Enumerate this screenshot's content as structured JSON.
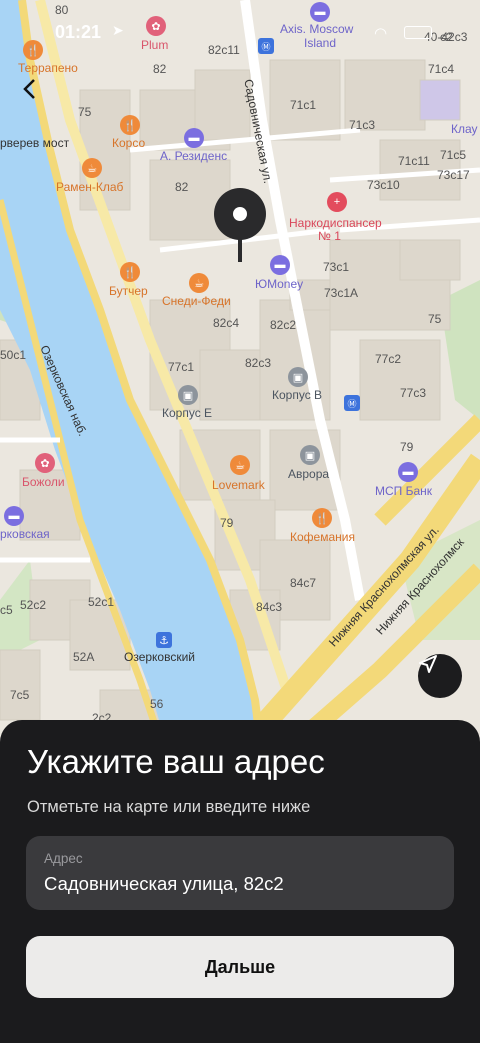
{
  "status_bar": {
    "time": "01:21"
  },
  "map": {
    "building_numbers": [
      "80",
      "82",
      "75",
      "82c11",
      "82",
      "82c4",
      "82c2",
      "77c1",
      "82c3",
      "79",
      "84c7",
      "84c3",
      "52c2",
      "52c1",
      "52A",
      "7c5",
      "c5",
      "50c1",
      "56",
      "2c2",
      "71c4",
      "71c1",
      "71c3",
      "71c11",
      "71c5",
      "73c10",
      "73c17",
      "73c1",
      "73c1A",
      "75",
      "77c2",
      "77c3",
      "79",
      "c2"
    ],
    "streets": [
      "Садовническая ул.",
      "Озерковская наб.",
      "Нижняя Краснохолмская ул.",
      "Нижняя Краснохолмск",
      "Краснохолмская ул.",
      "рверев мост"
    ],
    "pois": {
      "plum": "Plum",
      "terrapeno": "Террапено",
      "korso": "Корсо",
      "a_residence": "А. Резиденс",
      "ramen_club": "Рамен-Клаб",
      "narko": "Наркодиспансер",
      "narko_num": "№ 1",
      "butcher": "Бутчер",
      "snedi": "Снеди-Феди",
      "yumoney": "ЮMoney",
      "korpus_e": "Корпус Е",
      "korpus_v": "Корпус В",
      "lovemark": "Lovemark",
      "avrora": "Аврора",
      "msp": "МСП Банк",
      "kofemania": "Кофемания",
      "bozholi": "Божоли",
      "ozerkovskaya": "рковская",
      "ozerkovsky": "Озерковский",
      "axis1": "Axis. Moscow",
      "axis2": "Island",
      "klau": "Клау",
      "s4042": "40-42c3"
    }
  },
  "sheet": {
    "title": "Укажите ваш адрес",
    "subtitle": "Отметьте на карте или введите ниже",
    "address_label": "Адрес",
    "address_value": "Садовническая улица, 82с2",
    "next_button": "Дальше"
  }
}
